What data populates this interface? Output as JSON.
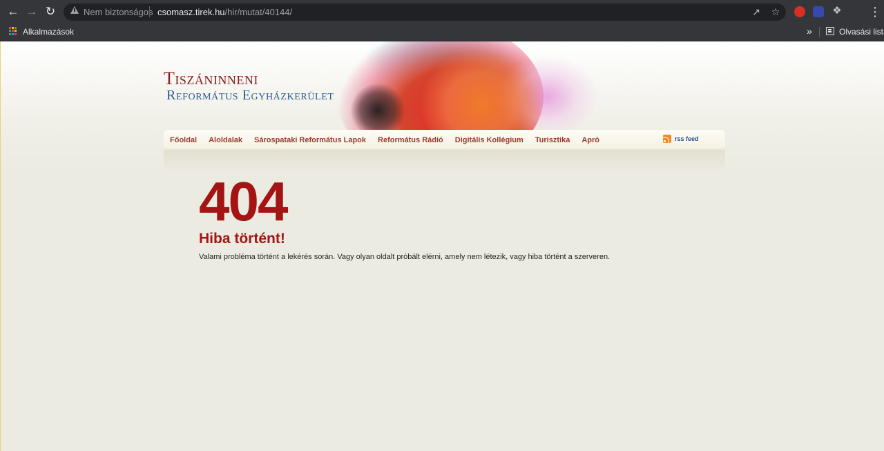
{
  "browser": {
    "security_label": "Nem biztonságos",
    "url_host": "csomasz.tirek.hu",
    "url_path": "/hir/mutat/40144/",
    "back_icon": "arrow-left-icon",
    "forward_icon": "arrow-right-icon",
    "reload_icon": "reload-icon",
    "apps_label": "Alkalmazások",
    "reading_list_label": "Olvasási lista"
  },
  "site": {
    "logo_line1": "Tiszáninneni",
    "logo_line2": "Református Egyházkerület",
    "menu": [
      {
        "label": "Főoldal"
      },
      {
        "label": "Aloldalak"
      },
      {
        "label": "Sárospataki Református Lapok"
      },
      {
        "label": "Református Rádió"
      },
      {
        "label": "Digitális Kollégium"
      },
      {
        "label": "Turisztika"
      },
      {
        "label": "Apró"
      }
    ],
    "rss_label": "rss feed"
  },
  "error": {
    "code": "404",
    "title": "Hiba történt!",
    "message": "Valami probléma történt a lekérés során. Vagy olyan oldalt próbált elérni, amely nem létezik, vagy hiba történt a szerveren."
  },
  "colors": {
    "error_red": "#a51414",
    "menu_text": "#9a3a2c",
    "logo_red": "#8a1c1f",
    "logo_blue": "#2a5a8a",
    "chrome_bg": "#35363a"
  }
}
